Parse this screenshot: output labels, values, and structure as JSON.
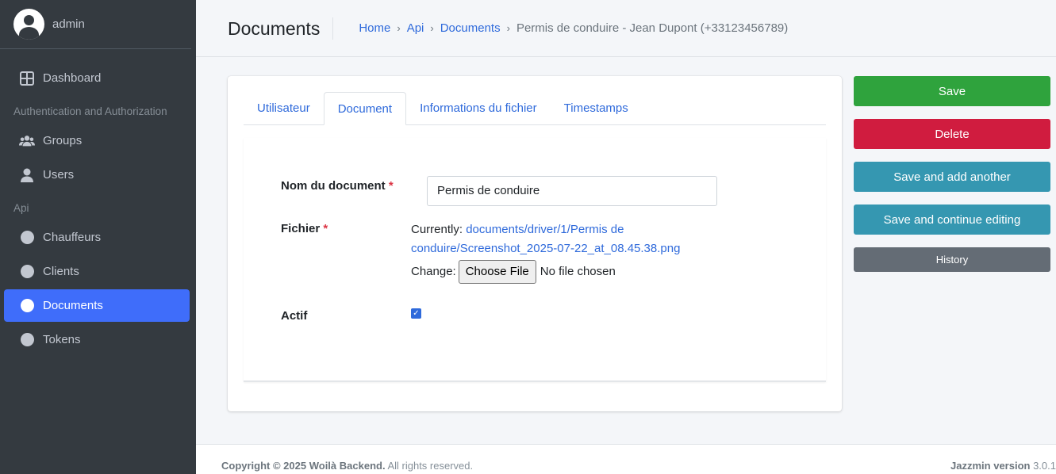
{
  "sidebar": {
    "user": "admin",
    "items": [
      {
        "label": "Dashboard"
      },
      {
        "label": "Groups"
      },
      {
        "label": "Users"
      },
      {
        "label": "Chauffeurs"
      },
      {
        "label": "Clients"
      },
      {
        "label": "Documents"
      },
      {
        "label": "Tokens"
      }
    ],
    "headers": [
      "Authentication and Authorization",
      "Api"
    ]
  },
  "header": {
    "title": "Documents",
    "breadcrumb": [
      "Home",
      "Api",
      "Documents"
    ],
    "breadcrumb_sep": "›",
    "current": "Permis de conduire - Jean Dupont (+33123456789)"
  },
  "tabs": [
    "Utilisateur",
    "Document",
    "Informations du fichier",
    "Timestamps"
  ],
  "form": {
    "name_label": "Nom du document",
    "name_value": "Permis de conduire",
    "file_label": "Fichier",
    "required_mark": "*",
    "currently_label": "Currently:",
    "currently_link_1": "documents/driver/1/Permis de",
    "currently_link_2": "conduire/Screenshot_2025-07-22_at_08.45.38.png",
    "change_label": "Change:",
    "choose_file": "Choose File",
    "no_file": "No file chosen",
    "active_label": "Actif",
    "active_checked": true
  },
  "actions": {
    "save": "Save",
    "delete": "Delete",
    "save_add": "Save and add another",
    "save_continue": "Save and continue editing",
    "history": "History"
  },
  "footer": {
    "copyright_bold": "Copyright © 2025 Woilà Backend.",
    "copyright_rest": " All rights reserved.",
    "version_bold": "Jazzmin version",
    "version": " 3.0.1"
  },
  "colors": {
    "sidebar_bg": "#343a40",
    "active_nav": "#3f6dfa",
    "link": "#2f6adb",
    "save": "#2fa33d",
    "delete": "#d01c3f",
    "info": "#3597b1",
    "history": "#646c75"
  }
}
